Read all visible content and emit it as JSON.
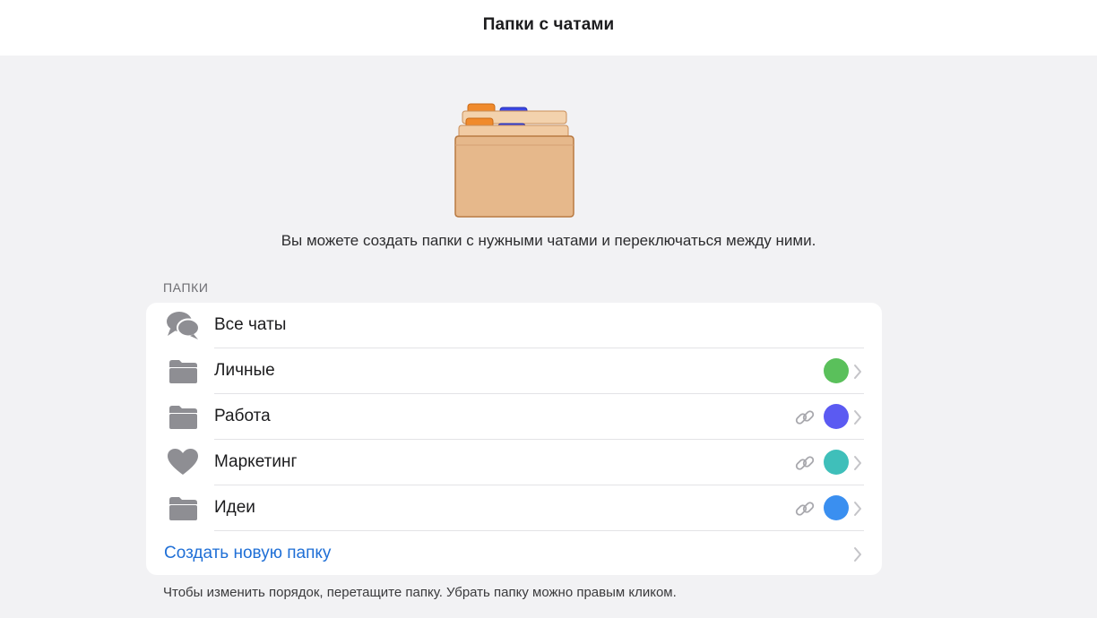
{
  "header": {
    "title": "Папки с чатами"
  },
  "hero": {
    "icon": "folders-cabinet-icon"
  },
  "description": "Вы можете создать папки с нужными чатами и переключаться между ними.",
  "folders_section": {
    "label": "ПАПКИ",
    "items": [
      {
        "label": "Все чаты",
        "icon": "chat-bubbles-icon",
        "shared": false,
        "color": null,
        "has_chevron": false
      },
      {
        "label": "Личные",
        "icon": "folder-icon",
        "shared": false,
        "color": "#5ac05b",
        "has_chevron": true
      },
      {
        "label": "Работа",
        "icon": "folder-icon",
        "shared": true,
        "color": "#5b5af2",
        "has_chevron": true
      },
      {
        "label": "Маркетинг",
        "icon": "heart-icon",
        "shared": true,
        "color": "#3fbfba",
        "has_chevron": true
      },
      {
        "label": "Идеи",
        "icon": "folder-icon",
        "shared": true,
        "color": "#3a8ff0",
        "has_chevron": true
      }
    ],
    "create_label": "Создать новую папку"
  },
  "footer_note": "Чтобы изменить порядок, перетащите папку. Убрать папку можно правым кликом.",
  "colors": {
    "accent_link": "#1f6fd6",
    "icon_gray": "#8e8e93"
  }
}
